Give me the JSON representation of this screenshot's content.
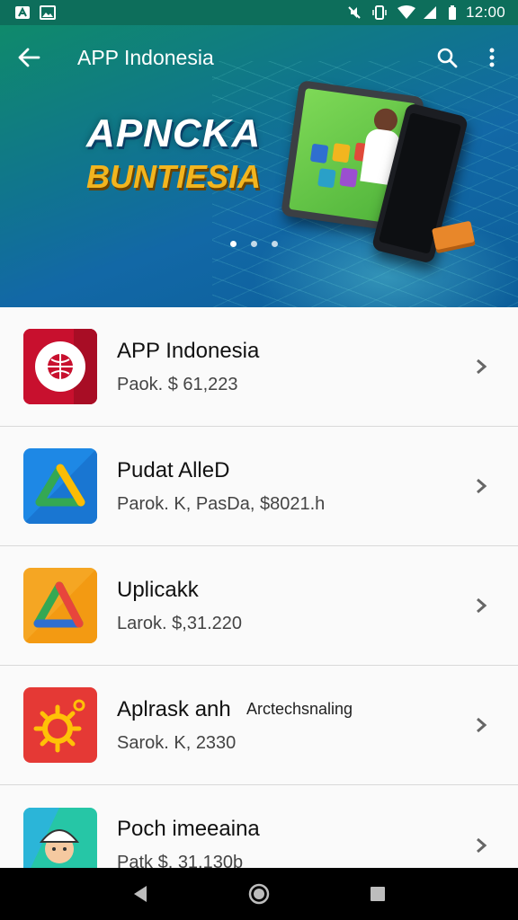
{
  "status_bar": {
    "time": "12:00",
    "left_icons": [
      "notification-a-icon",
      "image-icon"
    ],
    "right_icons": [
      "mute-icon",
      "vibrate-icon",
      "wifi-icon",
      "signal-icon",
      "battery-icon"
    ]
  },
  "app_bar": {
    "title": "APP Indonesia",
    "back_icon": "arrow-back-icon",
    "search_icon": "search-icon",
    "more_icon": "more-vert-icon"
  },
  "banner": {
    "line1": "APNCKA",
    "line2": "BUNTIESIA",
    "page_dots": 3,
    "active_dot": 0
  },
  "apps": [
    {
      "name": "APP Indonesia",
      "meta": "Paok. $ 61,223",
      "extra": "",
      "icon": "globe-shield-icon",
      "color": "#c8102e"
    },
    {
      "name": "Pudat AlleD",
      "meta": "Parok. K, PasDa, $8021.h",
      "extra": "",
      "icon": "triangle-logo-icon",
      "color": "#1e88e5"
    },
    {
      "name": "Uplicakk",
      "meta": "Larok. $,31.220",
      "extra": "",
      "icon": "triangle-logo-icon",
      "color": "#f5a623"
    },
    {
      "name": "Aplrask anh",
      "meta": "Sarok. K, 2330",
      "extra": "Arctechsnaling",
      "icon": "sun-gear-icon",
      "color": "#e53935"
    },
    {
      "name": "Poch imeeaina",
      "meta": "Patk $, 31.130b",
      "extra": "",
      "icon": "avatar-icon",
      "color": "#26c6a6"
    }
  ],
  "nav": {
    "back_icon": "nav-back-icon",
    "home_icon": "nav-home-icon",
    "recents_icon": "nav-recents-icon"
  },
  "colors": {
    "status_bar": "#0d6e5b",
    "banner_text_primary": "#ffffff",
    "banner_text_accent": "#f2b51f",
    "list_background": "#fafafa"
  }
}
